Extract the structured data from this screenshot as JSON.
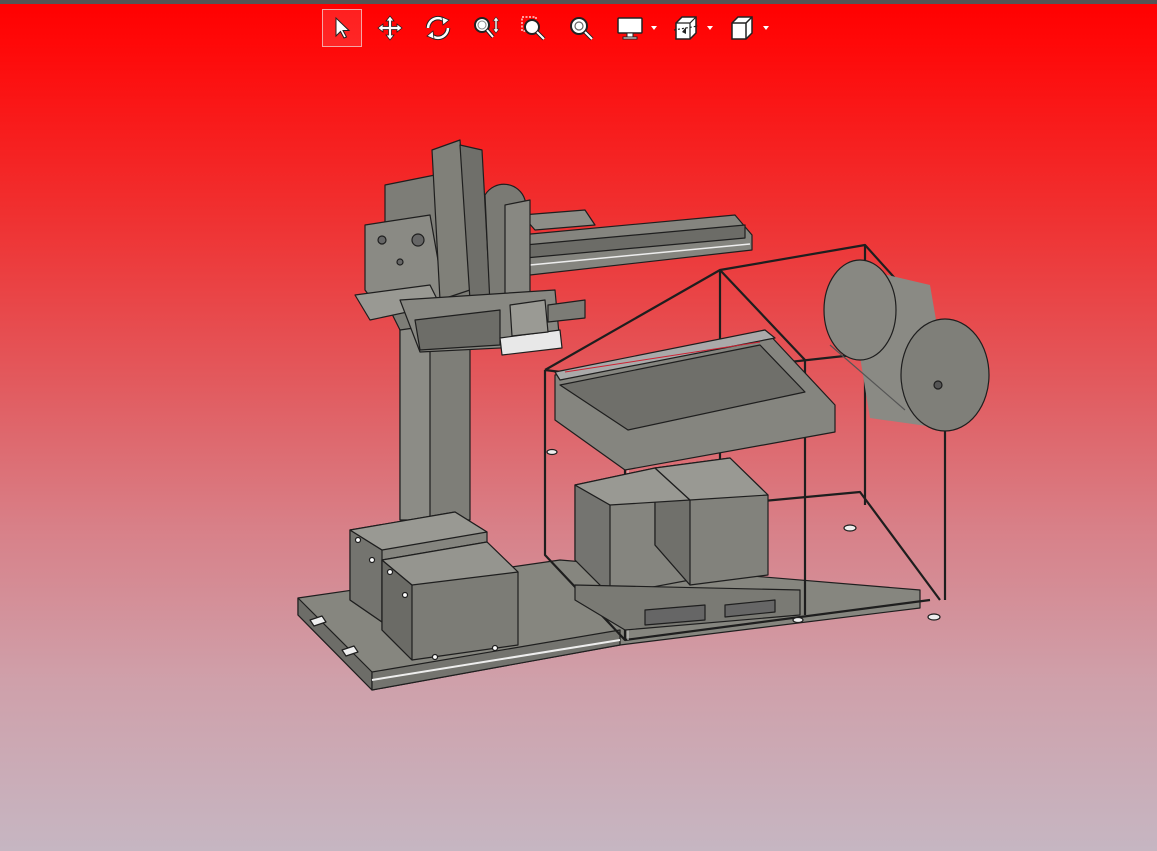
{
  "toolbar": {
    "tools": [
      {
        "icon": "select-arrow-icon",
        "active": true
      },
      {
        "icon": "pan-move-icon",
        "active": false
      },
      {
        "icon": "rotate-icon",
        "active": false
      },
      {
        "icon": "zoom-updown-icon",
        "active": false
      },
      {
        "icon": "zoom-window-icon",
        "active": false
      },
      {
        "icon": "zoom-fit-icon",
        "active": false
      },
      {
        "icon": "display-mode-icon",
        "active": false,
        "dropdown": true
      },
      {
        "icon": "section-view-icon",
        "active": false,
        "dropdown": true
      },
      {
        "icon": "view-cube-icon",
        "active": false,
        "dropdown": true
      }
    ]
  },
  "viewport": {
    "background_top": "#ff0000",
    "background_bottom": "#c6b6c2",
    "model_color": "#7c7c76",
    "edge_color": "#1e1e1e"
  }
}
